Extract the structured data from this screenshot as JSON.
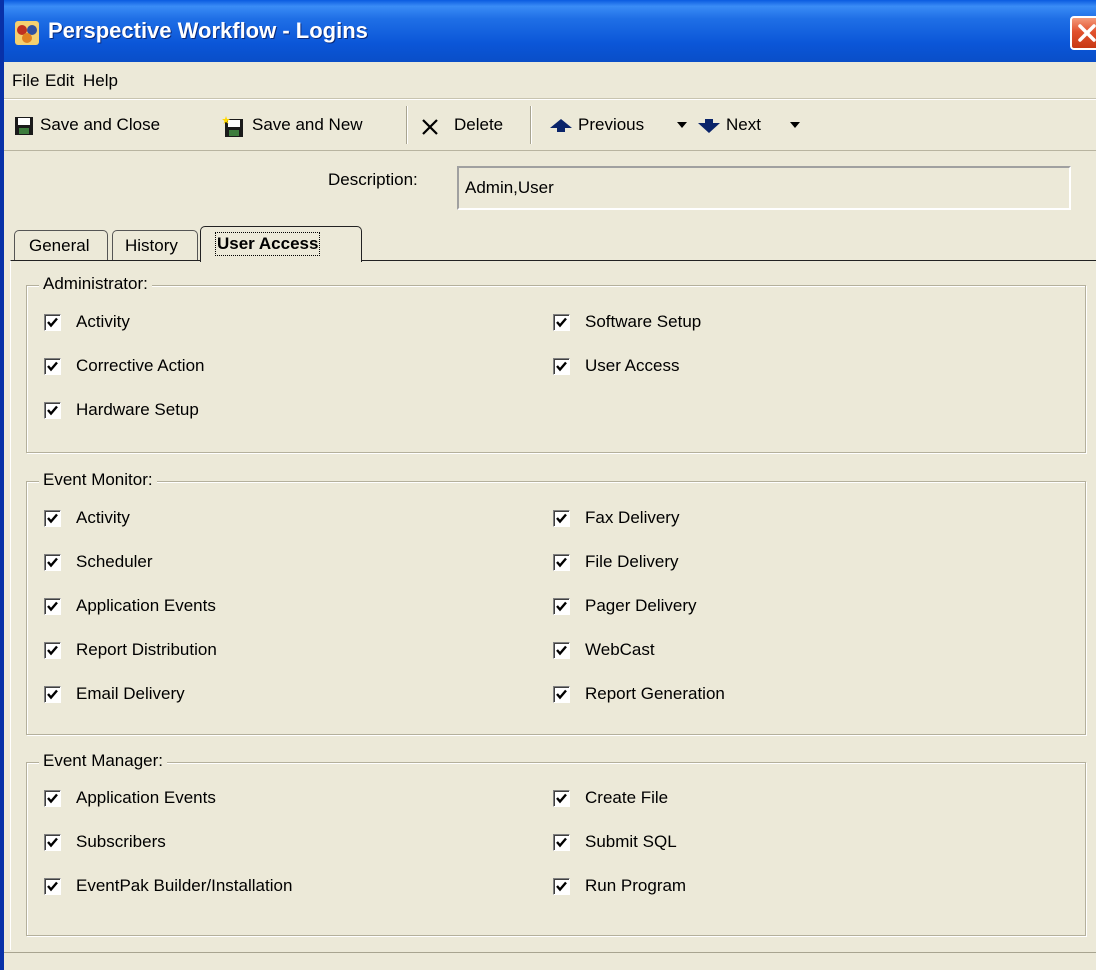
{
  "window": {
    "title": "Perspective Workflow - Logins"
  },
  "menu": [
    "File",
    "Edit",
    "Help"
  ],
  "toolbar": {
    "save_close": "Save and Close",
    "save_new": "Save and New",
    "delete": "Delete",
    "previous": "Previous",
    "next": "Next"
  },
  "description": {
    "label": "Description:",
    "value": "Admin,User"
  },
  "tabs": [
    "General",
    "History",
    "User Access"
  ],
  "active_tab": "User Access",
  "groups": [
    {
      "title": "Administrator:",
      "left": [
        {
          "label": "Activity",
          "checked": true
        },
        {
          "label": "Corrective Action",
          "checked": true
        },
        {
          "label": "Hardware Setup",
          "checked": true
        }
      ],
      "right": [
        {
          "label": "Software Setup",
          "checked": true
        },
        {
          "label": "User Access",
          "checked": true
        }
      ]
    },
    {
      "title": "Event Monitor:",
      "left": [
        {
          "label": "Activity",
          "checked": true
        },
        {
          "label": "Scheduler",
          "checked": true
        },
        {
          "label": "Application Events",
          "checked": true
        },
        {
          "label": "Report Distribution",
          "checked": true
        },
        {
          "label": "Email Delivery",
          "checked": true
        }
      ],
      "right": [
        {
          "label": "Fax Delivery",
          "checked": true
        },
        {
          "label": "File Delivery",
          "checked": true
        },
        {
          "label": "Pager Delivery",
          "checked": true
        },
        {
          "label": "WebCast",
          "checked": true
        },
        {
          "label": "Report Generation",
          "checked": true
        }
      ]
    },
    {
      "title": "Event Manager:",
      "left": [
        {
          "label": "Application Events",
          "checked": true
        },
        {
          "label": "Subscribers",
          "checked": true
        },
        {
          "label": "EventPak Builder/Installation",
          "checked": true
        }
      ],
      "right": [
        {
          "label": "Create File",
          "checked": true
        },
        {
          "label": "Submit SQL",
          "checked": true
        },
        {
          "label": "Run Program",
          "checked": true
        }
      ]
    }
  ],
  "colors": {
    "title_bar": "#0a56d8",
    "window_bg": "#ece9d8",
    "close_button": "#e2522e"
  },
  "icons": [
    "app-icon",
    "close-icon",
    "floppy-save-icon",
    "floppy-new-icon",
    "delete-x-icon",
    "up-arrow-icon",
    "down-arrow-icon",
    "dropdown-caret-icon",
    "checkmark-icon"
  ]
}
